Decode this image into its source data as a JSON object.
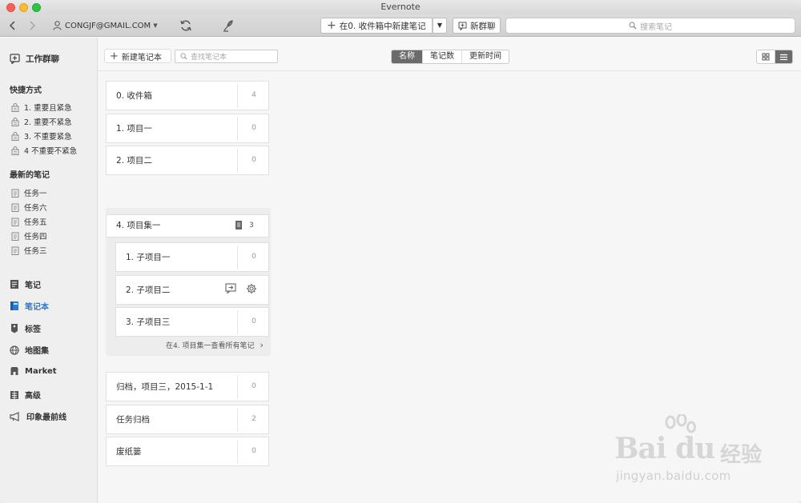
{
  "window": {
    "title": "Evernote"
  },
  "toolbar": {
    "account": "CONGJF@GMAIL.COM",
    "new_note_label": "在0. 收件箱中新建笔记",
    "new_chat_label": "新群聊",
    "search_placeholder": "搜索笔记"
  },
  "sidebar": {
    "work_chat": "工作群聊",
    "shortcuts_heading": "快捷方式",
    "shortcuts": [
      {
        "label": "1. 重要且紧急"
      },
      {
        "label": "2. 重要不紧急"
      },
      {
        "label": "3. 不重要紧急"
      },
      {
        "label": "4 不重要不紧急"
      }
    ],
    "recent_heading": "最新的笔记",
    "recent": [
      {
        "label": "任务一"
      },
      {
        "label": "任务六"
      },
      {
        "label": "任务五"
      },
      {
        "label": "任务四"
      },
      {
        "label": "任务三"
      }
    ],
    "main": [
      {
        "label": "笔记"
      },
      {
        "label": "笔记本"
      },
      {
        "label": "标签"
      },
      {
        "label": "地图集"
      },
      {
        "label": "Market"
      },
      {
        "label": "高级"
      },
      {
        "label": "印象最前线"
      }
    ],
    "accent_color": "#2a7bd4"
  },
  "content": {
    "new_notebook_label": "新建笔记本",
    "search_placeholder": "查找笔记本",
    "sort": [
      "名称",
      "笔记数",
      "更新时间"
    ],
    "sort_active": "名称",
    "notebooks_top": [
      {
        "name": "0. 收件箱",
        "count": "4"
      },
      {
        "name": "1. 项目一",
        "count": "0"
      },
      {
        "name": "2. 项目二",
        "count": "0"
      }
    ],
    "stack": {
      "name": "4. 项目集一",
      "count": "3",
      "children": [
        {
          "name": "1. 子项目一",
          "count": "0"
        },
        {
          "name": "2. 子项目二",
          "count": ""
        },
        {
          "name": "3. 子项目三",
          "count": "0"
        }
      ],
      "view_all": "在4. 项目集一查看所有笔记"
    },
    "notebooks_bottom": [
      {
        "name": "归档，项目三，2015-1-1",
        "count": "0"
      },
      {
        "name": "任务归档",
        "count": "2"
      },
      {
        "name": "废纸篓",
        "count": "0"
      }
    ]
  },
  "watermark": {
    "brand": "Bai du",
    "cn": "经验",
    "url": "jingyan.baidu.com"
  }
}
